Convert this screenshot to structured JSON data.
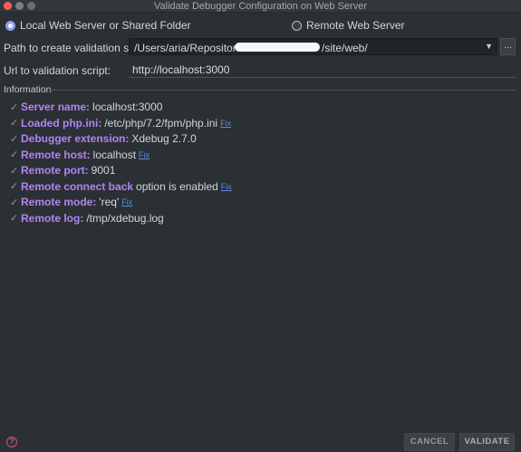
{
  "window": {
    "title": "Validate Debugger Configuration on Web Server"
  },
  "mode": {
    "local_label": "Local Web Server or Shared Folder",
    "remote_label": "Remote Web Server",
    "selected": "local"
  },
  "path_field": {
    "label": "Path to create validation script:",
    "value_prefix": "/Users/aria/Repositories/",
    "value_suffix": "/site/web/",
    "browse_label": "..."
  },
  "url_field": {
    "label": "Url to validation script:",
    "value": "http://localhost:3000"
  },
  "information": {
    "title": "Information",
    "rows": [
      {
        "key": "Server name:",
        "value": "localhost:3000",
        "link": ""
      },
      {
        "key": "Loaded php.ini:",
        "value": "/etc/php/7.2/fpm/php.ini",
        "link": "Fix"
      },
      {
        "key": "Debugger extension:",
        "value": "Xdebug 2.7.0",
        "link": ""
      },
      {
        "key": "Remote host:",
        "value": "localhost",
        "link": "Fix"
      },
      {
        "key": "Remote port:",
        "value": "9001",
        "link": ""
      },
      {
        "key": "Remote connect back",
        "value": "option is enabled",
        "link": "Fix"
      },
      {
        "key": "Remote mode:",
        "value": "'req'",
        "link": "Fix"
      },
      {
        "key": "Remote log:",
        "value": "/tmp/xdebug.log",
        "link": ""
      }
    ]
  },
  "buttons": {
    "cancel": "CANCEL",
    "validate": "VALIDATE"
  },
  "icons": {
    "check": "check-icon",
    "help": "help-icon",
    "dropdown": "chevron-down-icon"
  },
  "colors": {
    "accent": "#8f9bf6",
    "key": "#b284f0",
    "ok": "#6fb36f",
    "link": "#5e8cde",
    "help": "#d5556d"
  }
}
